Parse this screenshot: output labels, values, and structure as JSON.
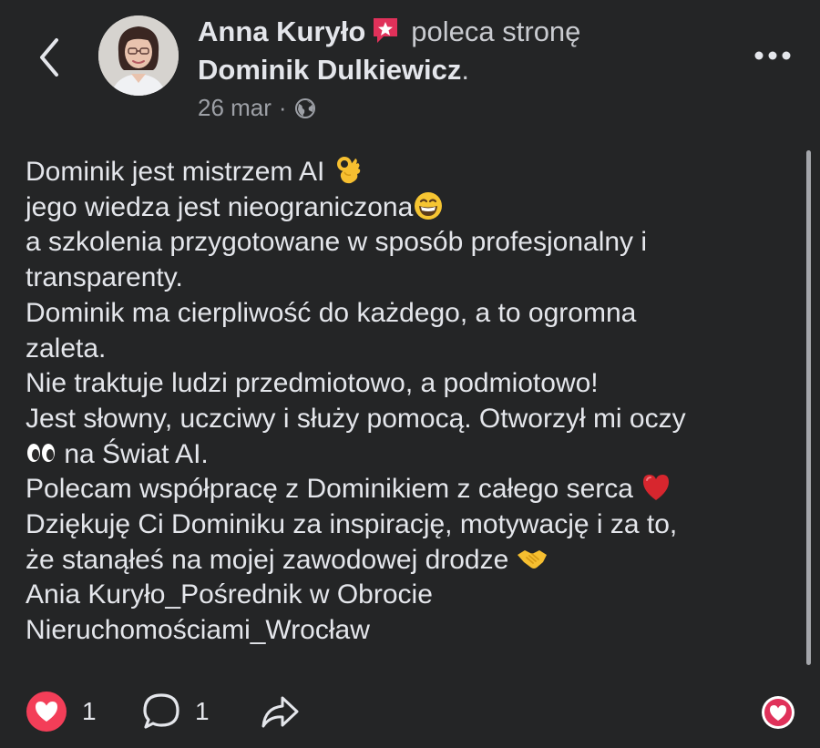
{
  "header": {
    "author_name": "Anna Kuryło",
    "verb": "poleca stronę",
    "page_name": "Dominik Dulkiewicz",
    "page_name_suffix": ".",
    "date": "26 mar",
    "separator": "·",
    "audience_icon": "globe-icon",
    "recommend_icon": "recommendation-badge-icon"
  },
  "post": {
    "lines": [
      "Dominik jest mistrzem AI",
      "jego wiedza jest nieograniczona",
      "a szkolenia przygotowane w sposób profesjonalny i",
      "transparenty.",
      "Dominik ma cierpliwość do każdego, a to ogromna",
      "zaleta.",
      "Nie traktuje ludzi przedmiotowo, a podmiotowo!",
      "Jest słowny, uczciwy i służy pomocą. Otworzył mi oczy",
      "na Świat AI.",
      "Polecam współpracę z Dominikiem z całego serca",
      "Dziękuję Ci Dominiku za inspirację, motywację i za to,",
      "że stanąłeś na mojej zawodowej drodze",
      "Ania Kuryło_Pośrednik w Obrocie",
      "Nieruchomościami_Wrocław"
    ],
    "emojis": [
      "ok-hand-emoji",
      "grinning-face-emoji",
      "eyes-emoji",
      "red-heart-emoji",
      "handshake-emoji"
    ]
  },
  "footer": {
    "likes_count": "1",
    "comments_count": "1"
  },
  "colors": {
    "background": "#242526",
    "text": "#e4e6eb",
    "muted": "#9da0a6",
    "love_red": "#f33e58",
    "badge_red": "#e0315a"
  }
}
